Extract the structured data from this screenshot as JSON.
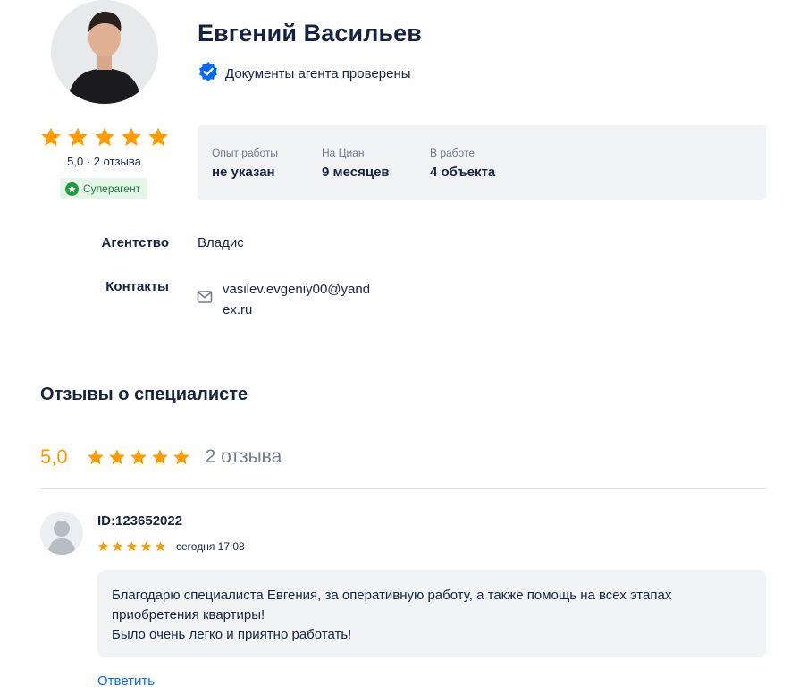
{
  "agent": {
    "name": "Евгений Васильев",
    "verified_text": "Документы агента проверены",
    "rating_summary": "5,0 · 2 отзыва",
    "badge": "Суперагент",
    "rating_stars": 5
  },
  "stats": [
    {
      "label": "Опыт работы",
      "value": "не указан"
    },
    {
      "label": "На Циан",
      "value": "9 месяцев"
    },
    {
      "label": "В работе",
      "value": "4 объекта"
    }
  ],
  "info": {
    "agency_label": "Агентство",
    "agency_value": "Владис",
    "contacts_label": "Контакты",
    "email_line1": "vasilev.evgeniy00@yand",
    "email_line2": "ex.ru"
  },
  "reviews_section": {
    "title": "Отзывы о специалисте",
    "score": "5,0",
    "count": "2 отзыва"
  },
  "review": {
    "author": "ID:123652022",
    "stars": 5,
    "date": "сегодня 17:08",
    "lines": [
      "Благодарю специалиста Евгения, за оперативную работу, а также помощь на всех этапах",
      "приобретения квартиры!",
      "Было очень легко и приятно работать!"
    ],
    "reply_label": "Ответить"
  },
  "colors": {
    "star": "#ff9d00",
    "accent_blue": "#0468ff",
    "badge_green": "#1a9c3a"
  },
  "icons": [
    "verified-check-icon",
    "star-icon",
    "superagent-star-icon",
    "mail-icon",
    "user-placeholder-icon"
  ]
}
